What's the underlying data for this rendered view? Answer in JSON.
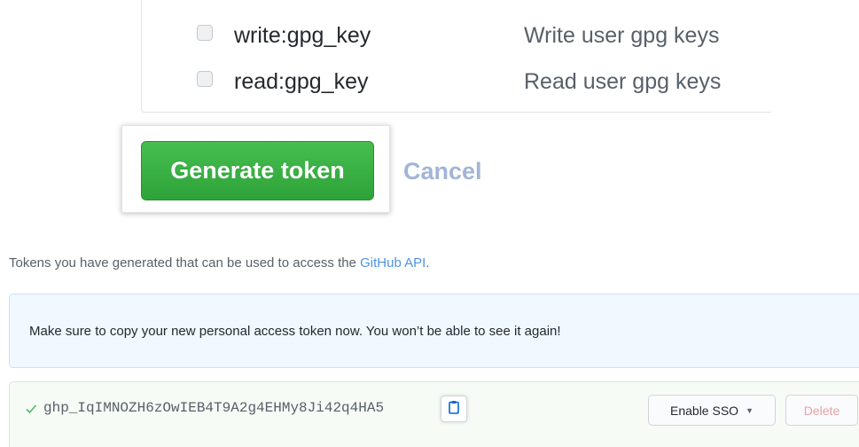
{
  "scopes": [
    {
      "name": "write:gpg_key",
      "description": "Write user gpg keys",
      "checked": false
    },
    {
      "name": "read:gpg_key",
      "description": "Read user gpg keys",
      "checked": false
    }
  ],
  "actions": {
    "generate_label": "Generate token",
    "cancel_label": "Cancel"
  },
  "intro": {
    "prefix": "Tokens you have generated that can be used to access the ",
    "link": "GitHub API",
    "suffix": "."
  },
  "notice": "Make sure to copy your new personal access token now. You won’t be able to see it again!",
  "token": {
    "value": "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",
    "enable_sso_label": "Enable SSO",
    "delete_label": "Delete"
  },
  "icons": {
    "check": "check-icon",
    "copy": "clipboard-icon",
    "caret": "caret-down-icon"
  },
  "colors": {
    "primary_button": "#2ea33a",
    "link": "#0366d6",
    "danger": "#cb2431"
  }
}
